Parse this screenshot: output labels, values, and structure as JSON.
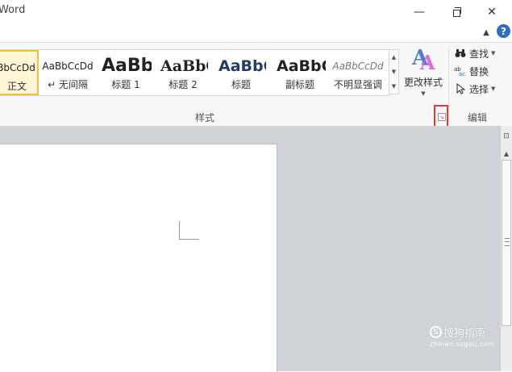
{
  "window": {
    "title": "Word",
    "minimize_glyph": "—",
    "close_glyph": "✕"
  },
  "ribbon_top": {
    "collapse_glyph": "▲",
    "help_glyph": "?"
  },
  "styles_gallery": {
    "items": [
      {
        "sample": "BbCcDd",
        "name": "正文",
        "selected": true
      },
      {
        "sample": "AaBbCcDd",
        "name": "↵ 无间隔"
      },
      {
        "sample": "AaBb",
        "name": "标题 1"
      },
      {
        "sample": "AaBbC",
        "name": "标题 2"
      },
      {
        "sample": "AaBbC",
        "name": "标题"
      },
      {
        "sample": "AaBbC",
        "name": "副标题"
      },
      {
        "sample": "AaBbCcDd",
        "name": "不明显强调"
      }
    ],
    "scroll_up": "▲",
    "scroll_down": "▼",
    "more": "▼"
  },
  "change_styles": {
    "label": "更改样式",
    "arrow": "▼",
    "icon": "change-styles-icon"
  },
  "groups": {
    "styles_label": "样式",
    "editing_label": "编辑"
  },
  "editing": {
    "find": "查找",
    "replace": "替换",
    "select": "选择",
    "caret": "▼"
  },
  "scrollbar": {
    "ruler_glyph": "⊡",
    "up_glyph": "▲"
  },
  "watermark": {
    "logo": "S",
    "text": "搜狗指南",
    "url": "zhinan.sogou.com"
  },
  "colors": {
    "highlight": "#e23a3a",
    "selected_style_border": "#f0c043",
    "help_blue": "#2f6cc4",
    "workspace": "#cfd3d8"
  }
}
